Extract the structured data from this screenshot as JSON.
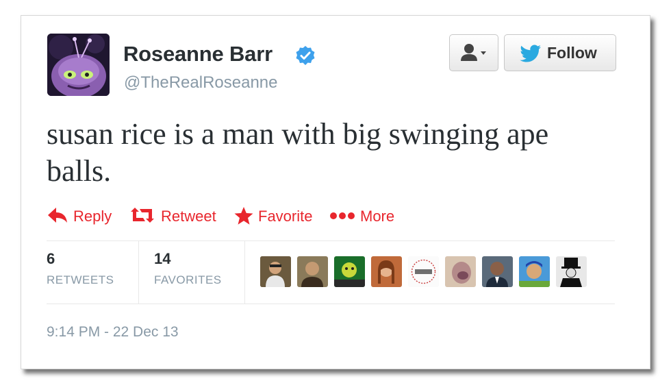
{
  "user": {
    "name": "Roseanne Barr",
    "handle": "@TheRealRoseanne",
    "verified_icon": "verified-badge-icon",
    "verified_color": "#3ea1ec"
  },
  "buttons": {
    "user_menu_icon": "user-dropdown-icon",
    "follow_label": "Follow",
    "follow_icon": "twitter-bird-icon"
  },
  "tweet": {
    "text": "susan rice is a man with big swinging ape balls."
  },
  "actions": {
    "reply": "Reply",
    "retweet": "Retweet",
    "favorite": "Favorite",
    "more": "More",
    "color": "#e8262d"
  },
  "stats": {
    "retweets": {
      "value": "6",
      "label": "RETWEETS"
    },
    "favorites": {
      "value": "14",
      "label": "FAVORITES"
    }
  },
  "favoriters": [
    "avatar-1",
    "avatar-2",
    "avatar-3",
    "avatar-4",
    "avatar-5",
    "avatar-6",
    "avatar-7",
    "avatar-8",
    "avatar-9"
  ],
  "timestamp": "9:14 PM - 22 Dec 13"
}
